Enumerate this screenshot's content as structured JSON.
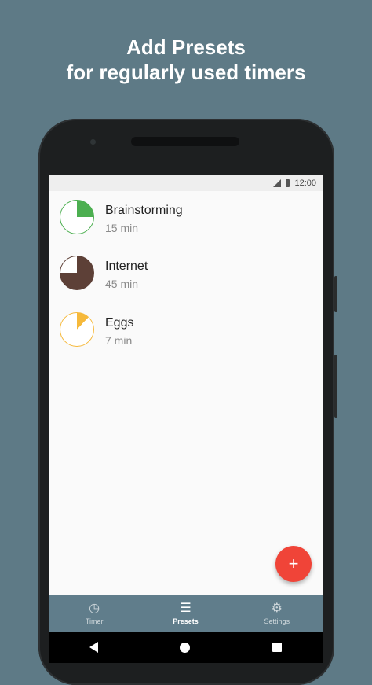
{
  "headline": {
    "line1": "Add Presets",
    "line2": "for regularly used timers"
  },
  "status_bar": {
    "time": "12:00"
  },
  "presets": [
    {
      "name": "Brainstorming",
      "duration": "15 min",
      "color": "#4caf50",
      "fraction": 0.25
    },
    {
      "name": "Internet",
      "duration": "45 min",
      "color": "#5d4037",
      "fraction": 0.75
    },
    {
      "name": "Eggs",
      "duration": "7 min",
      "color": "#f6b93b",
      "fraction": 0.12
    }
  ],
  "fab": {
    "label": "+"
  },
  "bottom_nav": {
    "items": [
      {
        "label": "Timer",
        "icon": "clock-icon"
      },
      {
        "label": "Presets",
        "icon": "list-icon",
        "active": true
      },
      {
        "label": "Settings",
        "icon": "gear-icon"
      }
    ]
  },
  "colors": {
    "background": "#5e7a86",
    "nav": "#607d8b",
    "fab": "#f04438"
  }
}
